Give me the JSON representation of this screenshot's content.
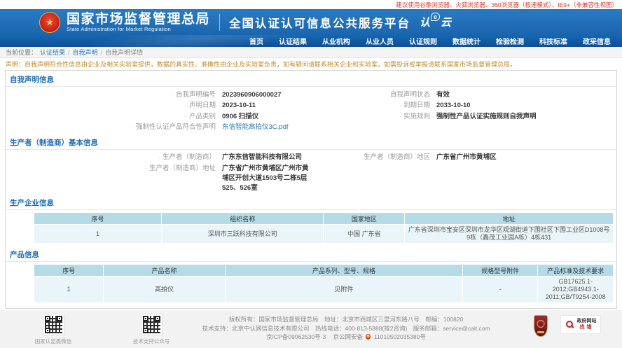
{
  "browser_tip": "建议使用谷歌浏览器、火狐浏览器、360浏览器（极速模式）、IE9+（非兼容性视图）",
  "header": {
    "agency_cn": "国家市场监督管理总局",
    "agency_en": "State Administration  for  Market Regulation",
    "platform": "全国认证认可信息公共服务平台",
    "logo": {
      "p1": "认",
      "p2": "e",
      "p3": "云"
    }
  },
  "nav": {
    "items": [
      "首页",
      "认证结果",
      "从业机构",
      "从业人员",
      "认证规则",
      "数据统计",
      "检验检测",
      "科技标准",
      "政采信息"
    ]
  },
  "breadcrumb": {
    "prefix": "当前位置：",
    "separator": "/",
    "items": [
      "认证结果",
      "自我声明",
      "自我声明详情"
    ]
  },
  "notice": "声明：自我声明符合性信息由企业及相关实验室提供，数据的真实性、准确性由企业及实验室负责，如有疑问请联系相关企业和实验室，如需投诉或举报请联系国家市场监督管理总局。",
  "sections": {
    "declaration": {
      "title": "自我声明信息",
      "left": [
        {
          "label": "自我声明编号",
          "value": "2023960906000027"
        },
        {
          "label": "声明日期",
          "value": "2023-10-11"
        },
        {
          "label": "产品类别",
          "value": "0906 扫描仪"
        },
        {
          "label": "强制性认证产品符合性声明",
          "value": "东信智能高拍仪3C.pdf"
        }
      ],
      "right": [
        {
          "label": "自我声明状态",
          "value": "有效"
        },
        {
          "label": "到期日期",
          "value": "2033-10-10"
        },
        {
          "label": "实施规则",
          "value": "强制性产品认证实施规则自我声明"
        }
      ]
    },
    "manufacturer": {
      "title": "生产者（制造商）基本信息",
      "left": [
        {
          "label": "生产者（制造商）",
          "value": "广东东信智能科技有限公司"
        },
        {
          "label": "生产者（制造商）地址",
          "value": "广东省广州市黄埔区广州市黄埔区开创大道1503号二栋5层525、526室"
        }
      ],
      "right": [
        {
          "label": "生产者（制造商）地区",
          "value": "广东省广州市黄埔区"
        }
      ]
    },
    "factory": {
      "title": "生产企业信息",
      "headers": [
        "序号",
        "组织名称",
        "国家地区",
        "地址"
      ],
      "rows": [
        [
          "1",
          "深圳市三跃科技有限公司",
          "中国 广东省",
          "广东省深圳市宝安区深圳市龙华区观湖街道下围社区下围工业区D1008号9栋（鑫茂工业园A栋）4栋431"
        ]
      ]
    },
    "product": {
      "title": "产品信息",
      "headers": [
        "序号",
        "产品名称",
        "产品系列、型号、规格",
        "规格型号附件",
        "产品标准及技术要求"
      ],
      "rows": [
        [
          "1",
          "高拍仪",
          "见附件",
          "-",
          "GB17625.1-2012;GB4943.1-2011;GB/T9254-2008"
        ]
      ]
    }
  },
  "footer": {
    "qr1_label": "国家认监委微信",
    "qr2_label": "技术支持公众号",
    "line1": "版权所有：国家市场监督管理总局　地址：北京市西城区三里河东路八号　邮编：100820",
    "line2": "技术支持：北京中认网信息技术有限公司　热线电话：400-813-5888(按2咨询)　服务邮箱：service@cait.com",
    "line3_icp": "京ICP备09062530号-3",
    "line3_psb": "京公网安备",
    "line3_psb_no": "11010502035380号",
    "err_badge": {
      "line1": "政府网站",
      "line2": "找错"
    }
  }
}
